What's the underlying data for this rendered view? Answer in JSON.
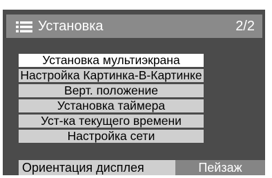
{
  "header": {
    "icon": "list-menu-icon",
    "title": "Установка",
    "page_indicator": "2/2"
  },
  "menu": {
    "items": [
      {
        "label": "Установка мультиэкрана",
        "selected": true
      },
      {
        "label": "Настройка Картинка-В-Картинке",
        "selected": false
      },
      {
        "label": "Верт. положение",
        "selected": false
      },
      {
        "label": "Установка таймера",
        "selected": false
      },
      {
        "label": "Уст-ка текущего времени",
        "selected": false
      },
      {
        "label": "Настройка сети",
        "selected": false
      }
    ]
  },
  "orientation": {
    "label": "Ориентация дисплея",
    "value": "Пейзаж"
  },
  "colors": {
    "panel": "#4b4b4b",
    "titlebar": "#8a8a8a",
    "item": "#cfcfcf",
    "item_selected": "#ffffff",
    "value_cell": "#858585"
  }
}
